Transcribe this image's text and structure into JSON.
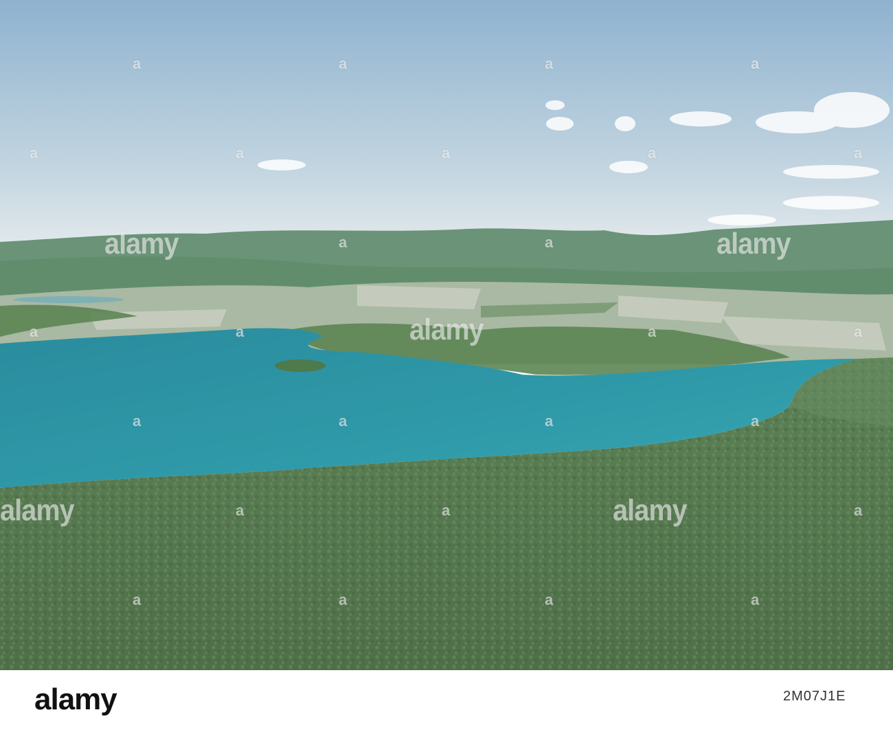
{
  "photo": {
    "description_colors": {
      "sky_top": "#8fb2cf",
      "sky_bottom": "#dde6ea",
      "hills": "#5f8f6c",
      "fields": "#b9c3b3",
      "lake": "#2e94a4",
      "forest": "#587a52"
    }
  },
  "watermark": {
    "brand": "alamy",
    "mark": "a"
  },
  "footer": {
    "logo": "alamy",
    "image_id": "2M07J1E"
  }
}
